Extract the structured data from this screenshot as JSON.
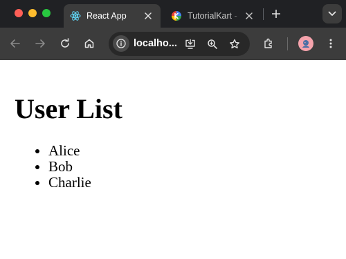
{
  "window": {
    "controls": [
      "close",
      "minimize",
      "maximize"
    ]
  },
  "tabs": [
    {
      "title": "React App",
      "favicon": "react-icon",
      "active": true
    },
    {
      "title": "TutorialKart - ",
      "favicon": "tutorialkart-icon",
      "active": false
    }
  ],
  "toolbar": {
    "url": "localho...",
    "icons": [
      "back-icon",
      "forward-icon",
      "reload-icon",
      "home-icon",
      "site-info-icon",
      "install-icon",
      "zoom-icon",
      "bookmark-star-icon",
      "extensions-icon",
      "profile-avatar",
      "menu-icon"
    ]
  },
  "page": {
    "heading": "User List",
    "users": [
      "Alice",
      "Bob",
      "Charlie"
    ]
  },
  "colors": {
    "tabstrip_bg": "#202124",
    "toolbar_bg": "#3c3c3c",
    "omnibox_bg": "#282828",
    "react_blue": "#61dafb",
    "page_bg": "#ffffff"
  }
}
